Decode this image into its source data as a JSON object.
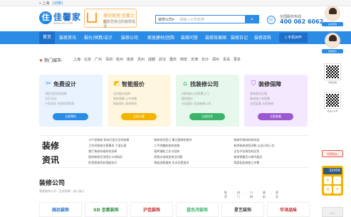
{
  "topbar": {
    "pin": "⌖",
    "city": "上海",
    "switch": "[切换]"
  },
  "header": {
    "logo_mark": "住",
    "logo_text": "佳馨家",
    "logo_url": "www.xxx.com",
    "slogan_line1": "美好家居 佳馨之选",
    "slogan_line2": "服务您身边的装修需求",
    "search_category": "装修公司▾",
    "search_placeholder": "请输入公司名称",
    "search_icon": "search-icon",
    "hotline_label": "全国服务热线",
    "hotline_number": "400 062 6062"
  },
  "nav": {
    "home": "首页",
    "items": [
      "装修资讯",
      "报价/预算/设计",
      "装修公司",
      "家居建材/团购",
      "装修问答",
      "装修效果图",
      "装修日记",
      "装修百科"
    ],
    "app": "▯ 手机APP"
  },
  "cities": {
    "label": "热门城市:",
    "list": [
      "上海",
      "北京",
      "广州",
      "深圳",
      "杭州",
      "南京",
      "苏州",
      "成都",
      "武汉",
      "重庆",
      "西安",
      "天津",
      "长沙",
      "郑州",
      "青岛",
      "更多"
    ]
  },
  "cards": [
    {
      "title": "免费设计",
      "icon": "✂",
      "lines": [
        "3套方案任你选择",
        "1对1设计",
        "户型优化 空间利用率高"
      ],
      "button": "立即预约",
      "color": "#e8f3ff",
      "accent": "#2b8ce6"
    },
    {
      "title": "智能报价",
      "icon": "◩",
      "lines": [
        "告别报价陷阱",
        "装修预算 心中有数",
        "精准报价 拒绝增项"
      ],
      "button": "立即计算",
      "color": "#fff6e0",
      "accent": "#f5b400"
    },
    {
      "title": "找装修公司",
      "icon": "⌂",
      "lines": [
        "3家装修公司免费上门",
        "量房报价",
        "对比报价 优选装修公司"
      ],
      "button": "立即找寻",
      "color": "#e6f7ec",
      "accent": "#3bb36a"
    },
    {
      "title": "装修保障",
      "icon": "⛉",
      "lines": [
        "装修款先托管",
        "装修施工有保障",
        "全程监督 无忧装修"
      ],
      "button": "立即查看",
      "color": "#f3e8ff",
      "accent": "#9b59d0"
    }
  ],
  "news": {
    "tag_line1": "装修",
    "tag_line2": "资讯",
    "columns": [
      [
        "小户型装修 如何打造大空间效果",
        "卫生间装修注意事项 干湿分离",
        "客厅装修风格如何选择",
        "厨房装修吊顶用什么材料好",
        "卧室装修色彩搭配技巧"
      ],
      [
        "装修合同签订 需注意哪些细节",
        "二手房翻新装修攻略",
        "瓷砖铺贴工艺与验收",
        "家装水电改造常见问题",
        "地板选购指南 实木还是复合"
      ],
      [
        "装修环保材料如何选",
        "新房装修流程详解 从设计到入住",
        "全包半包清包的区别",
        "装修预算怎么做不超支",
        "墙面乳胶漆施工步骤"
      ]
    ]
  },
  "section": {
    "title": "装修公司",
    "subtitle": "靠谱装修公司 · 品质保障 · 省心放心",
    "tabs": [
      "推荐",
      "热门",
      "口碑",
      "最新",
      "更多"
    ]
  },
  "brands": [
    {
      "name": "闽达装饰",
      "color": "#1e6fc9"
    },
    {
      "name": "SD 圣都装饰",
      "color": "#2f8f3a"
    },
    {
      "name": "沪佳装饰",
      "color": "#c4282a"
    },
    {
      "name": "蓝色河装饰",
      "color": "#3bb36a"
    },
    {
      "name": "星艺装饰",
      "color": "#444444"
    },
    {
      "name": "华浔品味",
      "color": "#c4282a"
    }
  ],
  "sidebar": {
    "avatar1_label": "在线咨询",
    "avatar2_label": "免费报价",
    "qr1_label": "手机扫码",
    "qr2_label": "关注公众号",
    "free_quote": "免费报价",
    "calc_display": "32456",
    "calc_keys": [
      "+",
      "-",
      "×",
      "÷"
    ],
    "back_top": "︿"
  }
}
